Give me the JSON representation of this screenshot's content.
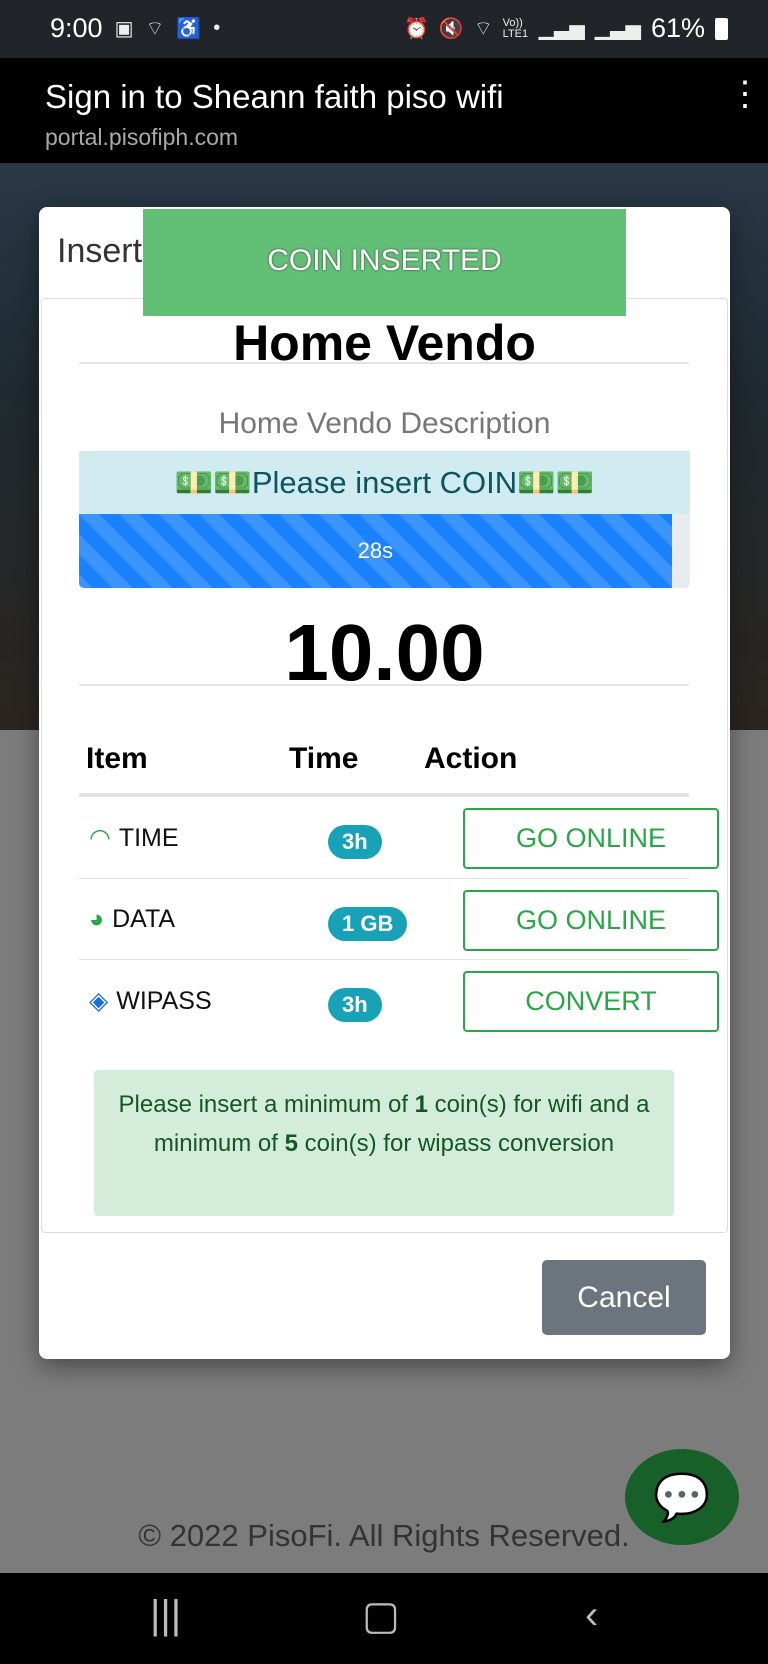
{
  "status_bar": {
    "time": "9:00",
    "battery": "61%",
    "left_icons": [
      "image-icon",
      "wifi-question-icon",
      "accessibility-icon",
      "dot-icon"
    ],
    "right_icons": [
      "alarm-icon",
      "mute-icon",
      "wifi-icon",
      "volte-icon",
      "signal-icon",
      "signal-icon",
      "battery-icon"
    ],
    "volte": "Vo)) LTE1"
  },
  "browser": {
    "title": "Sign in to Sheann faith piso wifi",
    "url": "portal.pisofiph.com"
  },
  "modal": {
    "header": "Insert Coin",
    "toast": "COIN INSERTED",
    "vendo_title": "Home Vendo",
    "vendo_description": "Home Vendo Description",
    "alert": "💵💵Please insert COIN💵💵",
    "progress": {
      "label": "28s",
      "percent": 97,
      "color": "#1a82ff"
    },
    "amount": "10.00",
    "table": {
      "headers": [
        "Item",
        "Time",
        "Action"
      ],
      "rows": [
        {
          "item": "TIME",
          "icon": "wifi-icon",
          "value": "3h",
          "action": "GO ONLINE"
        },
        {
          "item": "DATA",
          "icon": "dashboard-gauge-icon",
          "value": "1 GB",
          "action": "GO ONLINE"
        },
        {
          "item": "WIPASS",
          "icon": "ticket-icon",
          "value": "3h",
          "action": "CONVERT"
        }
      ]
    },
    "info": {
      "p1": "Please insert a minimum of ",
      "n1": "1",
      "p2": " coin(s) for wifi and a minimum of ",
      "n2": "5",
      "p3": " coin(s) for wipass conversion"
    },
    "cancel": "Cancel"
  },
  "footer": {
    "copyright": "© 2022 PisoFi. All Rights Reserved."
  },
  "colors": {
    "success": "#28a745",
    "toast": "#62bf76",
    "badge": "#17a2b8",
    "cancel": "#6c757d"
  }
}
